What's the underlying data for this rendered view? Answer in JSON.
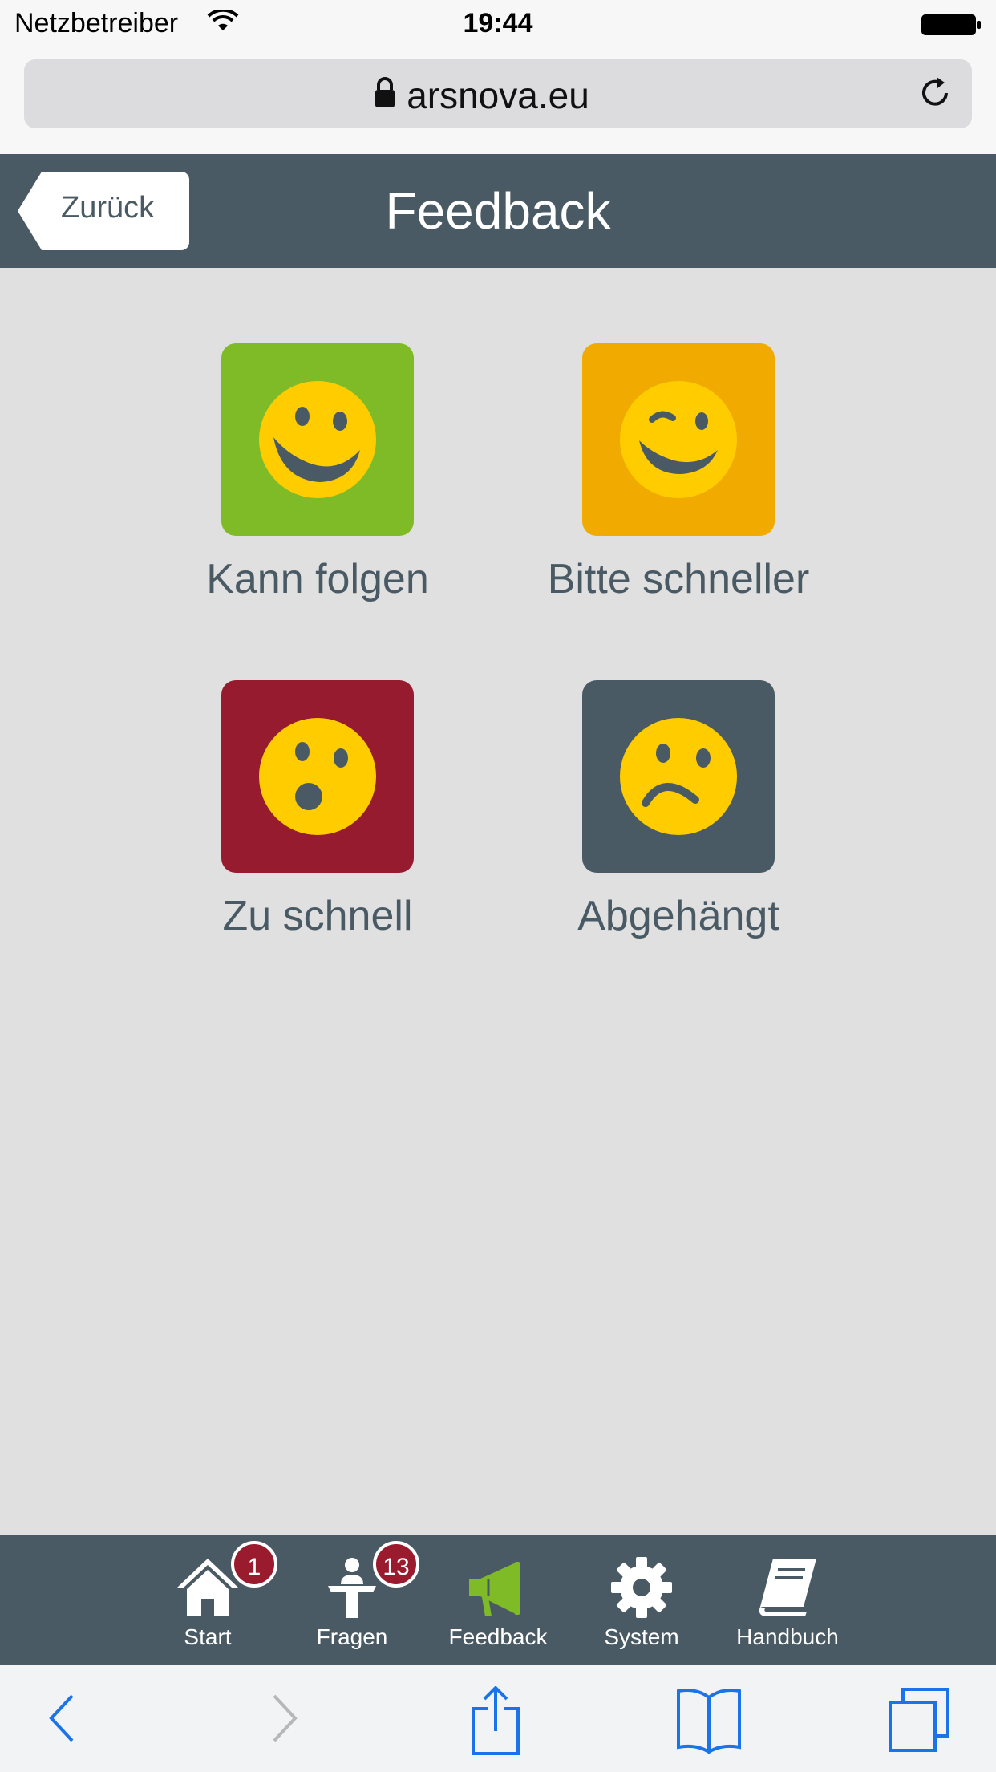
{
  "status_bar": {
    "carrier": "Netzbetreiber",
    "time": "19:44"
  },
  "browser": {
    "url": "arsnova.eu"
  },
  "header": {
    "title": "Feedback",
    "back_label": "Zurück"
  },
  "feedback_options": [
    {
      "label": "Kann folgen",
      "color": "#7fba27",
      "icon": "laughing-face-icon"
    },
    {
      "label": "Bitte schneller",
      "color": "#f0aa00",
      "icon": "winking-face-icon"
    },
    {
      "label": "Zu schnell",
      "color": "#971b2f",
      "icon": "surprised-face-icon"
    },
    {
      "label": "Abgehängt",
      "color": "#4a5a64",
      "icon": "sad-face-icon"
    }
  ],
  "tabs": [
    {
      "label": "Start",
      "icon": "home-icon",
      "badge": "1"
    },
    {
      "label": "Fragen",
      "icon": "presenter-icon",
      "badge": "13"
    },
    {
      "label": "Feedback",
      "icon": "megaphone-icon",
      "active": true
    },
    {
      "label": "System",
      "icon": "gear-icon"
    },
    {
      "label": "Handbuch",
      "icon": "book-icon"
    }
  ],
  "colors": {
    "header_bg": "#4a5a64",
    "face": "#ffcc00",
    "active_tab_icon": "#7fba27",
    "badge": "#9a1b2d",
    "safari_blue": "#1a73e8"
  }
}
